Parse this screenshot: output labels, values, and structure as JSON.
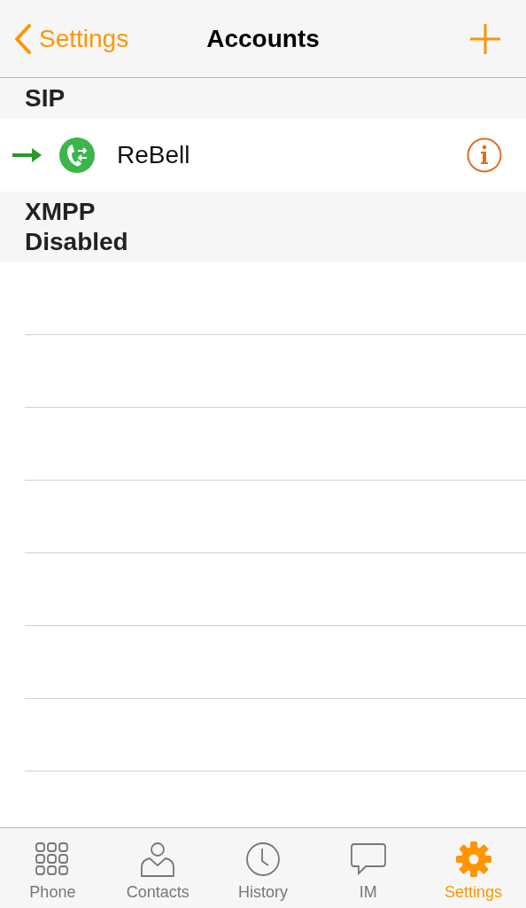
{
  "nav_bar": {
    "back_label": "Settings",
    "title": "Accounts"
  },
  "sections": [
    {
      "title": "SIP",
      "accounts": [
        {
          "name": "ReBell",
          "default": true
        }
      ]
    },
    {
      "title": "XMPP",
      "status": "Disabled"
    }
  ],
  "tab_bar": [
    {
      "kind": "keypad",
      "label": "Phone",
      "selected": false
    },
    {
      "kind": "person",
      "label": "Contacts",
      "selected": false
    },
    {
      "kind": "clock",
      "label": "History",
      "selected": false
    },
    {
      "kind": "chat",
      "label": "IM",
      "selected": false
    },
    {
      "kind": "gear",
      "label": "Settings",
      "selected": true
    }
  ]
}
